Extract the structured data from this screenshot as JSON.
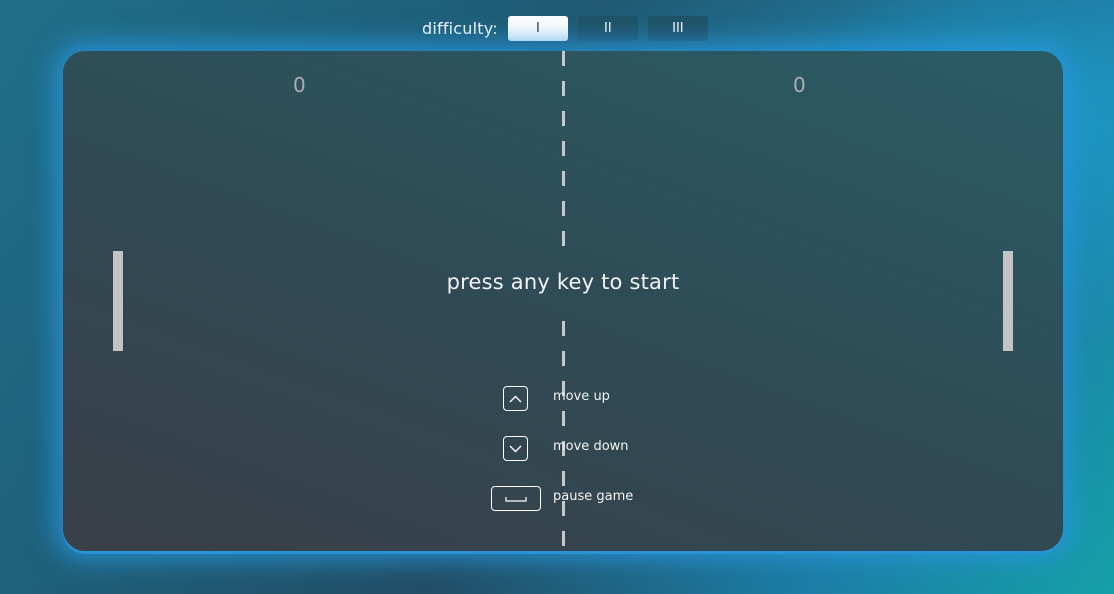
{
  "difficulty": {
    "label": "difficulty:",
    "options": [
      "I",
      "II",
      "III"
    ],
    "selected": "I"
  },
  "score": {
    "left": "0",
    "right": "0"
  },
  "message": "press any key to start",
  "controls": [
    {
      "key": "arrow-up",
      "label": "move up"
    },
    {
      "key": "arrow-down",
      "label": "move down"
    },
    {
      "key": "space",
      "label": "pause game"
    }
  ],
  "colors": {
    "board": "#2f4b55",
    "glow": "#2896dc",
    "paddle": "#c3c3c3",
    "active_button": "#ffffff",
    "inactive_button": "#1f5266"
  }
}
